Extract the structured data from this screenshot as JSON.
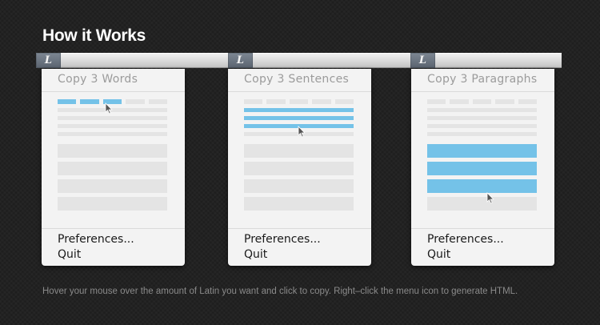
{
  "title": "How it Works",
  "menu_icon_glyph": "L",
  "accent_color": "#74c2e8",
  "panels": [
    {
      "title": "Copy 3 Words",
      "highlight": "words",
      "menu_items": [
        "Preferences...",
        "Quit"
      ]
    },
    {
      "title": "Copy 3 Sentences",
      "highlight": "sentences",
      "menu_items": [
        "Preferences...",
        "Quit"
      ]
    },
    {
      "title": "Copy 3 Paragraphs",
      "highlight": "paragraphs",
      "menu_items": [
        "Preferences...",
        "Quit"
      ]
    }
  ],
  "footer": "Hover your mouse over the amount of Latin you want and click to copy. Right–click the menu icon to generate HTML."
}
